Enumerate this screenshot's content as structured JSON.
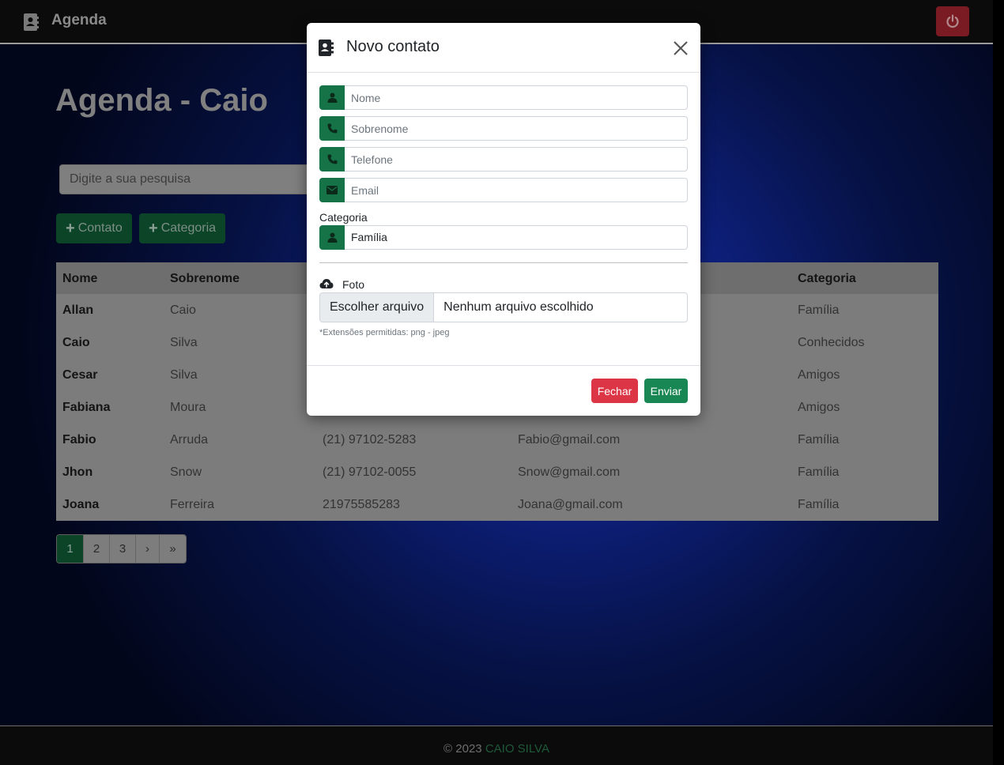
{
  "navbar": {
    "brand": "Agenda",
    "brand_icon": "address-book-icon",
    "logout_icon": "power-icon"
  },
  "main": {
    "title": "Agenda - Caio",
    "search_placeholder": "Digite a sua pesquisa",
    "add_contact_label": "Contato",
    "add_category_label": "Categoria"
  },
  "table": {
    "headers": {
      "nome": "Nome",
      "sobrenome": "Sobrenome",
      "categoria": "Categoria"
    },
    "rows": [
      {
        "nome": "Allan",
        "sobrenome": "Caio",
        "telefone": "",
        "email": "",
        "categoria": "Família"
      },
      {
        "nome": "Caio",
        "sobrenome": "Silva",
        "telefone": "",
        "email": "",
        "categoria": "Conhecidos"
      },
      {
        "nome": "Cesar",
        "sobrenome": "Silva",
        "telefone": "",
        "email": "",
        "categoria": "Amigos"
      },
      {
        "nome": "Fabiana",
        "sobrenome": "Moura",
        "telefone": "",
        "email": "",
        "categoria": "Amigos"
      },
      {
        "nome": "Fabio",
        "sobrenome": "Arruda",
        "telefone": "(21) 97102-5283",
        "email": "Fabio@gmail.com",
        "categoria": "Família"
      },
      {
        "nome": "Jhon",
        "sobrenome": "Snow",
        "telefone": "(21) 97102-0055",
        "email": "Snow@gmail.com",
        "categoria": "Família"
      },
      {
        "nome": "Joana",
        "sobrenome": "Ferreira",
        "telefone": "21975585283",
        "email": "Joana@gmail.com",
        "categoria": "Família"
      }
    ]
  },
  "pagination": {
    "pages": [
      "1",
      "2",
      "3",
      "›",
      "»"
    ],
    "active": "1"
  },
  "footer": {
    "copyright": "© 2023",
    "author": "CAIO SILVA"
  },
  "modal": {
    "title": "Novo contato",
    "fields": {
      "nome_placeholder": "Nome",
      "sobrenome_placeholder": "Sobrenome",
      "telefone_placeholder": "Telefone",
      "email_placeholder": "Email"
    },
    "category_label": "Categoria",
    "category_value": "Família",
    "photo_label": "Foto",
    "file_button": "Escolher arquivo",
    "file_status": "Nenhum arquivo escolhido",
    "file_hint": "*Extensões permitidas: png - jpeg",
    "close_button": "Fechar",
    "submit_button": "Enviar"
  },
  "colors": {
    "accent_green": "#198754",
    "danger_red": "#dc3545"
  }
}
